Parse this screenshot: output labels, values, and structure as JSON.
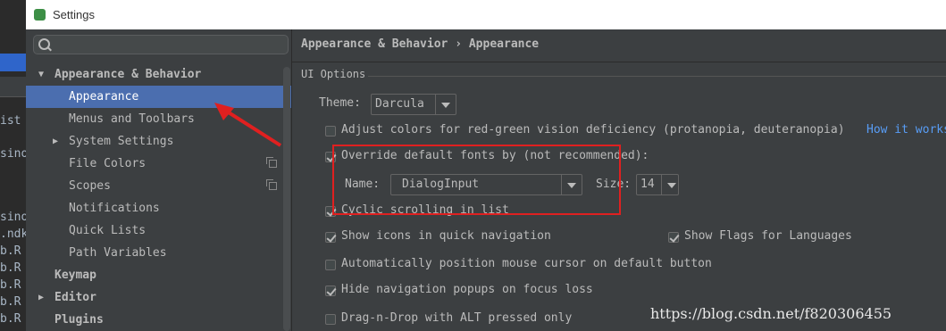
{
  "window": {
    "title": "Settings"
  },
  "background_ide_lines": [
    "ist",
    "sino",
    "sino",
    ".ndk",
    "b.R",
    "b.R",
    "b.R",
    "b.R",
    "b.R"
  ],
  "search": {
    "value": "",
    "placeholder": ""
  },
  "tree": [
    {
      "label": "Appearance & Behavior",
      "bold": true,
      "expanded": true,
      "level": 0
    },
    {
      "label": "Appearance",
      "selected": true,
      "level": 1
    },
    {
      "label": "Menus and Toolbars",
      "level": 1
    },
    {
      "label": "System Settings",
      "collapsed": true,
      "level": 1
    },
    {
      "label": "File Colors",
      "level": 1,
      "copy_icon": true
    },
    {
      "label": "Scopes",
      "level": 1,
      "copy_icon": true
    },
    {
      "label": "Notifications",
      "level": 1
    },
    {
      "label": "Quick Lists",
      "level": 1
    },
    {
      "label": "Path Variables",
      "level": 1
    },
    {
      "label": "Keymap",
      "bold": true,
      "level": 0
    },
    {
      "label": "Editor",
      "bold": true,
      "collapsed": true,
      "level": 0
    },
    {
      "label": "Plugins",
      "bold": true,
      "level": 0
    }
  ],
  "breadcrumb": {
    "parent": "Appearance & Behavior",
    "separator": "›",
    "current": "Appearance"
  },
  "ui_options": {
    "group_title": "UI Options",
    "theme_label": "Theme:",
    "theme_value": "Darcula",
    "adjust_colors": {
      "label": "Adjust colors for red-green vision deficiency (protanopia, deuteranopia)",
      "checked": false,
      "link": "How it works"
    },
    "override_fonts": {
      "label": "Override default fonts by (not recommended):",
      "checked": true
    },
    "font_name_label": "Name:",
    "font_name_value": "DialogInput",
    "font_size_label": "Size:",
    "font_size_value": "14",
    "cyclic_scrolling": {
      "label": "Cyclic scrolling in list",
      "checked": true
    },
    "show_icons": {
      "label": "Show icons in quick navigation",
      "checked": true
    },
    "show_flags": {
      "label": "Show Flags for Languages",
      "checked": true
    },
    "auto_position": {
      "label": "Automatically position mouse cursor on default button",
      "checked": false
    },
    "hide_nav": {
      "label": "Hide navigation popups on focus loss",
      "checked": true
    },
    "drag_drop": {
      "label": "Drag-n-Drop with ALT pressed only",
      "checked": false
    }
  },
  "watermark": "https://blog.csdn.net/f820306455",
  "colors": {
    "selection": "#4b6eaf",
    "annotation": "#e02020",
    "link": "#589df6",
    "background": "#3c3f41"
  }
}
